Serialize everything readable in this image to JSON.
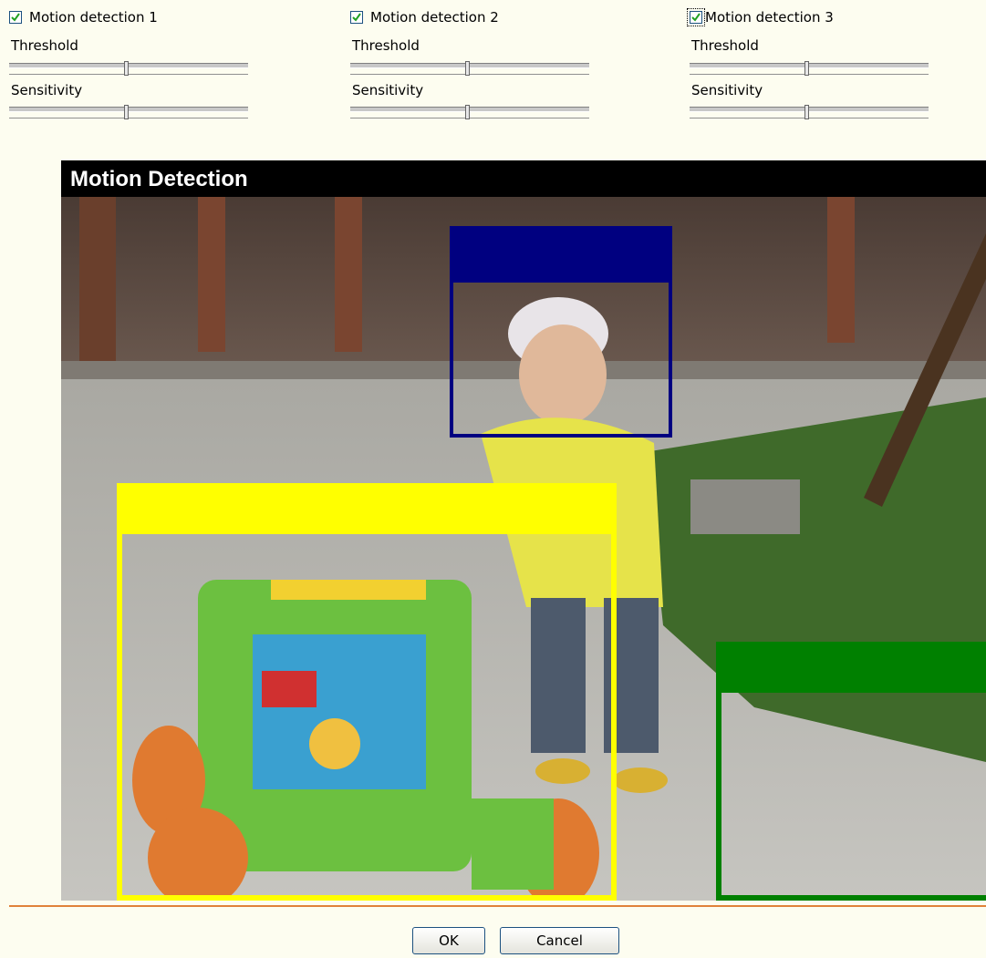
{
  "zones": [
    {
      "label": "Motion detection 1",
      "checked": true,
      "threshold_label": "Threshold",
      "sensitivity_label": "Sensitivity",
      "threshold_value": 50,
      "sensitivity_value": 50
    },
    {
      "label": "Motion detection 2",
      "checked": true,
      "threshold_label": "Threshold",
      "sensitivity_label": "Sensitivity",
      "threshold_value": 50,
      "sensitivity_value": 50
    },
    {
      "label": "Motion detection 3",
      "checked": true,
      "threshold_label": "Threshold",
      "sensitivity_label": "Sensitivity",
      "threshold_value": 50,
      "sensitivity_value": 50
    }
  ],
  "video": {
    "title": "Motion Detection"
  },
  "motion_zone_colors": {
    "zone1": "#ffff00",
    "zone2": "#000080",
    "zone3": "#008000"
  },
  "colors": {
    "accent_line": "#e0823a",
    "page_bg": "#fdfdf0"
  },
  "buttons": {
    "ok": "OK",
    "cancel": "Cancel"
  }
}
